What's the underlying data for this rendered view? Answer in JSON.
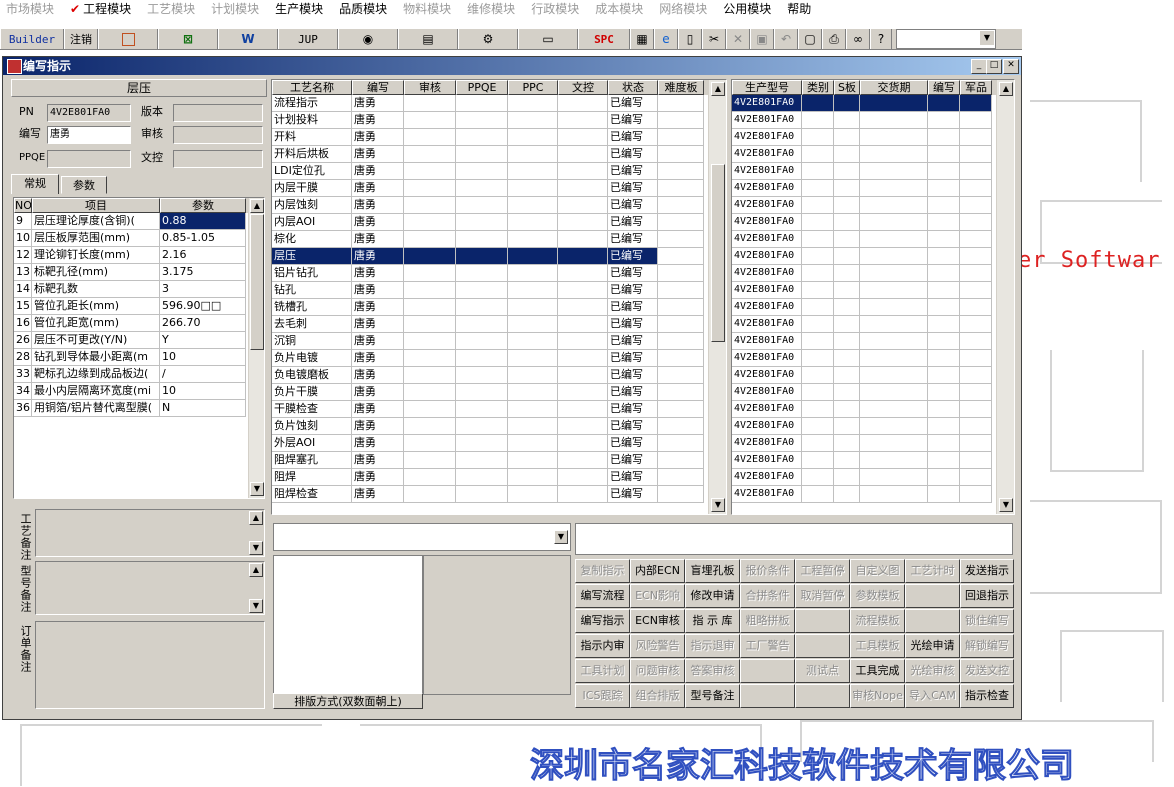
{
  "menu": [
    {
      "label": "市场模块",
      "enabled": false
    },
    {
      "label": "工程模块",
      "enabled": true,
      "checked": true
    },
    {
      "label": "工艺模块",
      "enabled": false
    },
    {
      "label": "计划模块",
      "enabled": false
    },
    {
      "label": "生产模块",
      "enabled": true
    },
    {
      "label": "品质模块",
      "enabled": true
    },
    {
      "label": "物料模块",
      "enabled": false
    },
    {
      "label": "维修模块",
      "enabled": false
    },
    {
      "label": "行政模块",
      "enabled": false
    },
    {
      "label": "成本模块",
      "enabled": false
    },
    {
      "label": "网络模块",
      "enabled": false
    },
    {
      "label": "公用模块",
      "enabled": true
    },
    {
      "label": "帮助",
      "enabled": true
    }
  ],
  "toolbar": {
    "builder": "Builder",
    "logout": "注销",
    "jup": "JUP",
    "spc": "SPC"
  },
  "background": {
    "text": "er Softwar",
    "bottom_text": "深圳市名家汇科技软件技术有限公司"
  },
  "window": {
    "title": "编写指示"
  },
  "left": {
    "section_title": "层压",
    "pn_label": "PN",
    "pn_value": "4V2E801FA0",
    "version_label": "版本",
    "version_value": "",
    "author_label": "编写",
    "author_value": "唐勇",
    "review_label": "审核",
    "review_value": "",
    "ppqe_label": "PPQE",
    "ppqe_value": "",
    "doc_label": "文控",
    "doc_value": "",
    "tabs": [
      "常规",
      "参数"
    ],
    "param_headers": [
      "NO",
      "项目",
      "参数"
    ],
    "params": [
      [
        "9",
        "层压理论厚度(含铜)(",
        "0.88"
      ],
      [
        "10",
        "层压板厚范围(mm)",
        "0.85-1.05"
      ],
      [
        "12",
        "理论铆钉长度(mm)",
        "2.16"
      ],
      [
        "13",
        "标靶孔径(mm)",
        "3.175"
      ],
      [
        "14",
        "标靶孔数",
        "3"
      ],
      [
        "15",
        "管位孔距长(mm)",
        "596.90□□"
      ],
      [
        "16",
        "管位孔距宽(mm)",
        "266.70"
      ],
      [
        "26",
        "层压不可更改(Y/N)",
        "Y"
      ],
      [
        "28",
        "钻孔到导体最小距离(m",
        "10"
      ],
      [
        "33",
        "靶标孔边缘到成品板边(",
        "/"
      ],
      [
        "34",
        "最小内层隔离环宽度(mi",
        "10"
      ],
      [
        "36",
        "用铜箔/铝片替代离型膜(",
        "N"
      ]
    ],
    "note_craft": "工艺备注",
    "note_model": "型号备注",
    "note_order": "订单备注"
  },
  "process": {
    "headers": [
      "工艺名称",
      "编写",
      "审核",
      "PPQE",
      "PPC",
      "文控",
      "状态",
      "难度板"
    ],
    "rows": [
      [
        "流程指示",
        "唐勇",
        "",
        "",
        "",
        "",
        "已编写",
        ""
      ],
      [
        "计划投料",
        "唐勇",
        "",
        "",
        "",
        "",
        "已编写",
        ""
      ],
      [
        "开料",
        "唐勇",
        "",
        "",
        "",
        "",
        "已编写",
        ""
      ],
      [
        "开料后烘板",
        "唐勇",
        "",
        "",
        "",
        "",
        "已编写",
        ""
      ],
      [
        "LDI定位孔",
        "唐勇",
        "",
        "",
        "",
        "",
        "已编写",
        ""
      ],
      [
        "内层干膜",
        "唐勇",
        "",
        "",
        "",
        "",
        "已编写",
        ""
      ],
      [
        "内层蚀刻",
        "唐勇",
        "",
        "",
        "",
        "",
        "已编写",
        ""
      ],
      [
        "内层AOI",
        "唐勇",
        "",
        "",
        "",
        "",
        "已编写",
        ""
      ],
      [
        "棕化",
        "唐勇",
        "",
        "",
        "",
        "",
        "已编写",
        ""
      ],
      [
        "层压",
        "唐勇",
        "",
        "",
        "",
        "",
        "已编写",
        ""
      ],
      [
        "铝片钻孔",
        "唐勇",
        "",
        "",
        "",
        "",
        "已编写",
        ""
      ],
      [
        "钻孔",
        "唐勇",
        "",
        "",
        "",
        "",
        "已编写",
        ""
      ],
      [
        "铣槽孔",
        "唐勇",
        "",
        "",
        "",
        "",
        "已编写",
        ""
      ],
      [
        "去毛刺",
        "唐勇",
        "",
        "",
        "",
        "",
        "已编写",
        ""
      ],
      [
        "沉铜",
        "唐勇",
        "",
        "",
        "",
        "",
        "已编写",
        ""
      ],
      [
        "负片电镀",
        "唐勇",
        "",
        "",
        "",
        "",
        "已编写",
        ""
      ],
      [
        "负电镀磨板",
        "唐勇",
        "",
        "",
        "",
        "",
        "已编写",
        ""
      ],
      [
        "负片干膜",
        "唐勇",
        "",
        "",
        "",
        "",
        "已编写",
        ""
      ],
      [
        "干膜检查",
        "唐勇",
        "",
        "",
        "",
        "",
        "已编写",
        ""
      ],
      [
        "负片蚀刻",
        "唐勇",
        "",
        "",
        "",
        "",
        "已编写",
        ""
      ],
      [
        "外层AOI",
        "唐勇",
        "",
        "",
        "",
        "",
        "已编写",
        ""
      ],
      [
        "阻焊塞孔",
        "唐勇",
        "",
        "",
        "",
        "",
        "已编写",
        ""
      ],
      [
        "阻焊",
        "唐勇",
        "",
        "",
        "",
        "",
        "已编写",
        ""
      ],
      [
        "阻焊检查",
        "唐勇",
        "",
        "",
        "",
        "",
        "已编写",
        ""
      ]
    ],
    "selected_index": 9
  },
  "models": {
    "headers": [
      "生产型号",
      "类别",
      "S板",
      "交货期",
      "编写",
      "军品"
    ],
    "row_value": "4V2E801FA0",
    "row_count": 24
  },
  "layout_label": "排版方式(双数面朝上)",
  "buttons": [
    [
      {
        "label": "复制指示",
        "enabled": false
      },
      {
        "label": "内部ECN",
        "enabled": true
      },
      {
        "label": "盲埋孔板",
        "enabled": true
      },
      {
        "label": "报价条件",
        "enabled": false
      },
      {
        "label": "工程暂停",
        "enabled": false
      },
      {
        "label": "自定义图",
        "enabled": false
      },
      {
        "label": "工艺计时",
        "enabled": false
      },
      {
        "label": "发送指示",
        "enabled": true
      }
    ],
    [
      {
        "label": "编写流程",
        "enabled": true
      },
      {
        "label": "ECN影响",
        "enabled": false
      },
      {
        "label": "修改申请",
        "enabled": true
      },
      {
        "label": "合拼条件",
        "enabled": false
      },
      {
        "label": "取消暂停",
        "enabled": false
      },
      {
        "label": "参数模板",
        "enabled": false
      },
      {
        "label": "",
        "enabled": false
      },
      {
        "label": "回退指示",
        "enabled": true
      }
    ],
    [
      {
        "label": "编写指示",
        "enabled": true
      },
      {
        "label": "ECN审核",
        "enabled": true
      },
      {
        "label": "指 示 库",
        "enabled": true
      },
      {
        "label": "粗略拼板",
        "enabled": false
      },
      {
        "label": "",
        "enabled": false
      },
      {
        "label": "流程模板",
        "enabled": false
      },
      {
        "label": "",
        "enabled": false
      },
      {
        "label": "锁住编写",
        "enabled": false
      }
    ],
    [
      {
        "label": "指示内审",
        "enabled": true
      },
      {
        "label": "风险警告",
        "enabled": false
      },
      {
        "label": "指示退审",
        "enabled": false
      },
      {
        "label": "工厂警告",
        "enabled": false
      },
      {
        "label": "",
        "enabled": false
      },
      {
        "label": "工具模板",
        "enabled": false
      },
      {
        "label": "光绘申请",
        "enabled": true
      },
      {
        "label": "解锁编写",
        "enabled": false
      }
    ],
    [
      {
        "label": "工具计划",
        "enabled": false
      },
      {
        "label": "问题审核",
        "enabled": false
      },
      {
        "label": "答案审核",
        "enabled": false
      },
      {
        "label": "",
        "enabled": false
      },
      {
        "label": "测试点",
        "enabled": false
      },
      {
        "label": "工具完成",
        "enabled": true
      },
      {
        "label": "光绘审核",
        "enabled": false
      },
      {
        "label": "发送文控",
        "enabled": false
      }
    ],
    [
      {
        "label": "ICS跟踪",
        "enabled": false
      },
      {
        "label": "组合排版",
        "enabled": false
      },
      {
        "label": "型号备注",
        "enabled": true
      },
      {
        "label": "",
        "enabled": false
      },
      {
        "label": "",
        "enabled": false
      },
      {
        "label": "审核Nope",
        "enabled": false
      },
      {
        "label": "导入CAM",
        "enabled": false
      },
      {
        "label": "指示检查",
        "enabled": true
      }
    ]
  ]
}
